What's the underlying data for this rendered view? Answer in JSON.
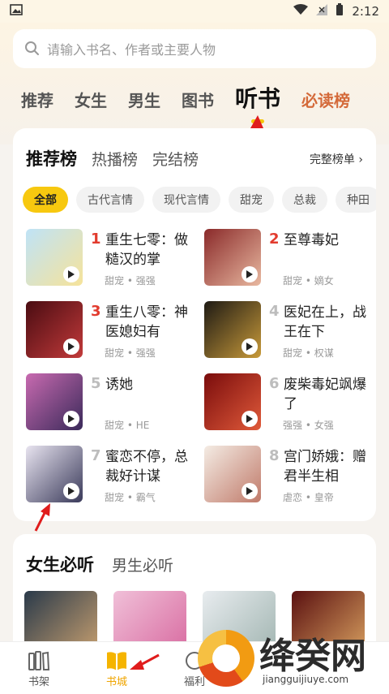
{
  "status": {
    "time": "2:12"
  },
  "search": {
    "placeholder": "请输入书名、作者或主要人物"
  },
  "top_tabs": [
    "推荐",
    "女生",
    "男生",
    "图书",
    "听书",
    "必读榜"
  ],
  "rank_card": {
    "tabs": [
      "推荐榜",
      "热播榜",
      "完结榜"
    ],
    "more": "完整榜单 ›",
    "chips": [
      "全部",
      "古代言情",
      "现代言情",
      "甜宠",
      "总裁",
      "种田"
    ],
    "books": [
      {
        "rank": "1",
        "title": "重生七零：做糙汉的掌",
        "tags": "甜宠 • 强强"
      },
      {
        "rank": "2",
        "title": "至尊毒妃",
        "tags": "甜宠 • 嫡女"
      },
      {
        "rank": "3",
        "title": "重生八零：神医媳妇有",
        "tags": "甜宠 • 强强"
      },
      {
        "rank": "4",
        "title": "医妃在上，战王在下",
        "tags": "甜宠 • 权谋"
      },
      {
        "rank": "5",
        "title": "诱她",
        "tags": "甜宠 • HE"
      },
      {
        "rank": "6",
        "title": "废柴毒妃飒爆了",
        "tags": "强强 • 女强"
      },
      {
        "rank": "7",
        "title": "蜜恋不停，总裁好计谋",
        "tags": "甜宠 • 霸气"
      },
      {
        "rank": "8",
        "title": "宫门娇娥：赠君半生相",
        "tags": "虐恋 • 皇帝"
      }
    ]
  },
  "section2": {
    "tabs": [
      "女生必听",
      "男生必听"
    ]
  },
  "bottom_nav": [
    "书架",
    "书城",
    "福利"
  ],
  "watermark": {
    "text": "绛癸网",
    "url": "jiangguijiuye.com"
  },
  "colors": {
    "accent": "#f7c80f",
    "rank_red": "#e23b2e"
  }
}
